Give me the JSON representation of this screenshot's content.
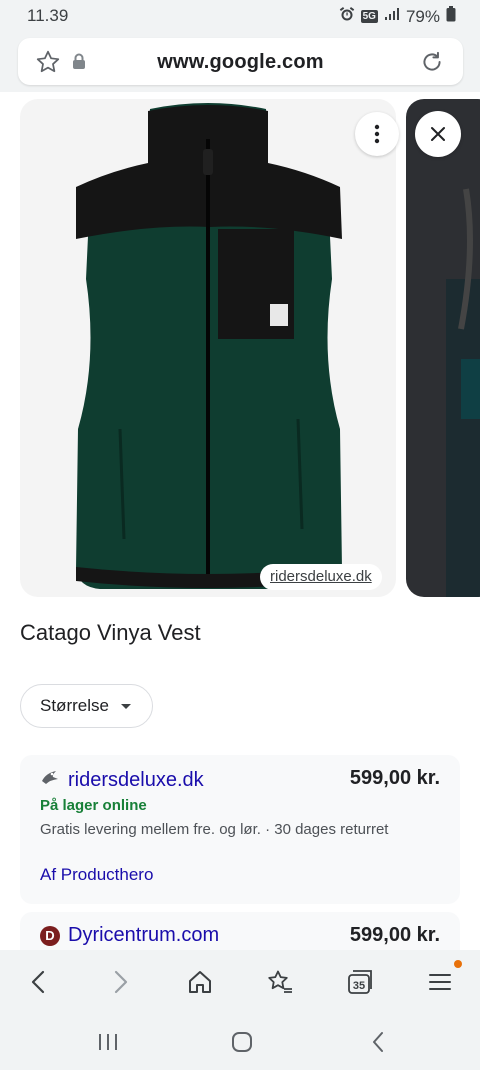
{
  "status_bar": {
    "time": "11.39",
    "network": "5G",
    "battery": "79%",
    "icons": [
      "alarm-icon",
      "5g-icon",
      "signal-icon",
      "battery-icon"
    ]
  },
  "browser": {
    "url": "www.google.com",
    "icons": [
      "star-icon",
      "lock-icon",
      "reload-icon"
    ]
  },
  "product": {
    "image_source": "ridersdeluxe.dk",
    "title": "Catago Vinya Vest",
    "size_filter_label": "Størrelse"
  },
  "offers": [
    {
      "store": "ridersdeluxe.dk",
      "price": "599,00 kr.",
      "stock": "På lager online",
      "delivery": "Gratis levering mellem fre. og lør. · 30 dages returret",
      "by": "Af Producthero"
    },
    {
      "store": "Dyricentrum.com",
      "price": "599,00 kr.",
      "favicon_letter": "D"
    }
  ],
  "toolbar": {
    "tab_count": "35",
    "items": [
      "back-icon",
      "forward-icon",
      "home-icon",
      "bookmarks-icon",
      "tabs-icon",
      "menu-icon"
    ]
  },
  "colors": {
    "link": "#1a0dab",
    "in_stock": "#188038",
    "vest_green": "#0f3d30",
    "vest_black": "#151515",
    "notification": "#e8710a"
  }
}
